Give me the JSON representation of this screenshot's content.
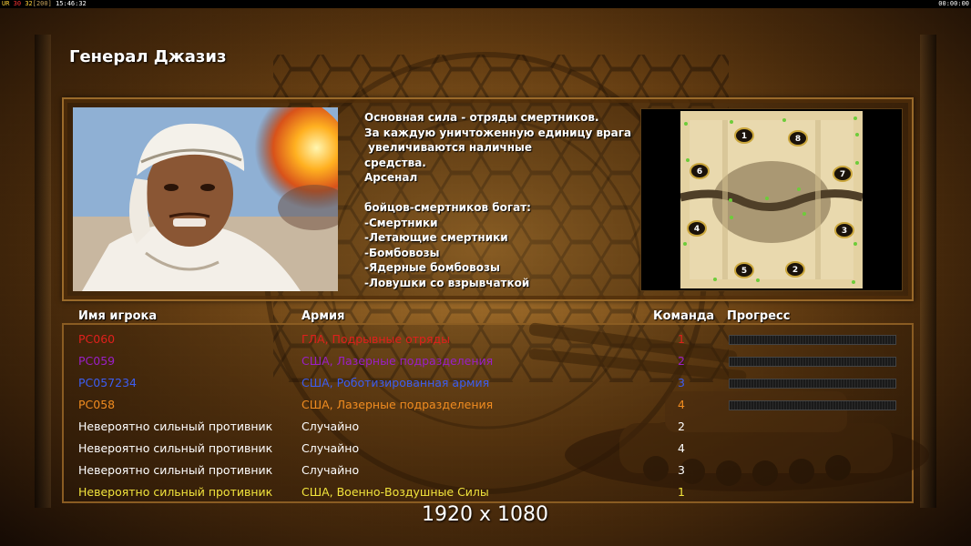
{
  "status_bar": {
    "left_a": "UR",
    "left_b": "30",
    "left_c": "32",
    "left_d": "[200]",
    "left_time": "15:46:32",
    "right_time": "00:00:00"
  },
  "general": {
    "title": "Генерал Джазиз",
    "description_lines": [
      "Основная сила - отряды смертников.",
      "За каждую уничтоженную единицу врага",
      " увеличиваются наличные",
      "средства.",
      "Арсенал",
      "",
      "бойцов-смертников богат:",
      "-Смертники",
      "-Летающие смертники",
      "-Бомбовозы",
      "-Ядерные бомбовозы",
      "-Ловушки со взрывчаткой"
    ]
  },
  "minimap": {
    "start_positions": [
      "1",
      "2",
      "3",
      "4",
      "5",
      "6",
      "7",
      "8"
    ]
  },
  "table": {
    "headers": {
      "player": "Имя игрока",
      "army": "Армия",
      "team": "Команда",
      "progress": "Прогресс"
    },
    "rows": [
      {
        "name": "PC060",
        "army": "ГЛА, Подрывные отряды",
        "team": "1",
        "color": "#e0201c",
        "progress": 0
      },
      {
        "name": "PC059",
        "army": "США, Лазерные подразделения",
        "team": "2",
        "color": "#9a1fc6",
        "progress": 0
      },
      {
        "name": "PC057234",
        "army": "США, Роботизированная армия",
        "team": "3",
        "color": "#3c5df0",
        "progress": 0
      },
      {
        "name": "PC058",
        "army": "США, Лазерные подразделения",
        "team": "4",
        "color": "#f08c20",
        "progress": 0
      },
      {
        "name": "Невероятно сильный противник",
        "army": "Случайно",
        "team": "2",
        "color": "#ffffff"
      },
      {
        "name": "Невероятно сильный противник",
        "army": "Случайно",
        "team": "4",
        "color": "#ffffff"
      },
      {
        "name": "Невероятно сильный противник",
        "army": "Случайно",
        "team": "3",
        "color": "#ffffff"
      },
      {
        "name": "Невероятно сильный противник",
        "army": "США, Военно-Воздушные Силы",
        "team": "1",
        "color": "#f2e43c"
      }
    ]
  },
  "resolution_label": "1920 x 1080"
}
